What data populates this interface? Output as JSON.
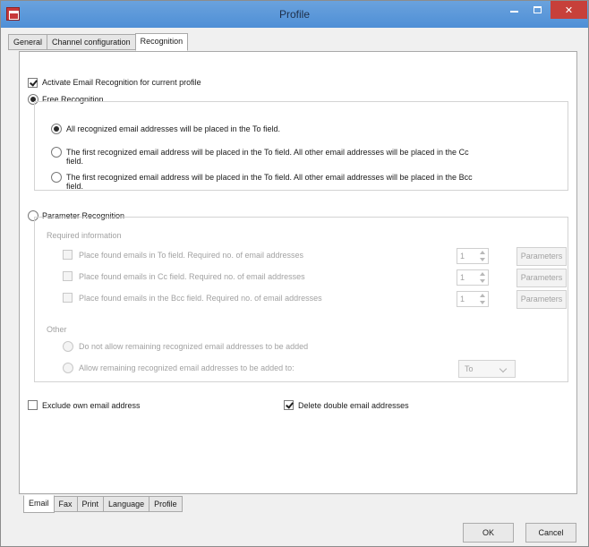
{
  "window": {
    "title": "Profile"
  },
  "top_tabs": [
    "General",
    "Channel configuration",
    "Recognition"
  ],
  "recognition": {
    "activate_label": "Activate Email Recognition for current profile",
    "activate_checked": true,
    "free_recognition": {
      "label": "Free Recognition",
      "selected": true,
      "options": [
        {
          "line1": "All recognized email addresses will be placed in the To field.",
          "line2": "",
          "selected": true
        },
        {
          "line1": "The first recognized email address will be placed in the To field. All other email addresses will be placed in the Cc",
          "line2": "field.",
          "selected": false
        },
        {
          "line1": "The first recognized email address will be placed in the To field. All other email addresses will be placed in the Bcc",
          "line2": "field.",
          "selected": false
        }
      ]
    },
    "parameter_recognition": {
      "label": "Parameter Recognition",
      "selected": false,
      "required_heading": "Required information",
      "rows": [
        {
          "label": "Place found emails in To field. Required no. of email addresses",
          "value": "1",
          "button": "Parameters"
        },
        {
          "label": "Place found emails in Cc field. Required no. of email addresses",
          "value": "1",
          "button": "Parameters"
        },
        {
          "label": "Place found emails in the Bcc field. Required no. of email addresses",
          "value": "1",
          "button": "Parameters"
        }
      ],
      "other_heading": "Other",
      "other_options": [
        {
          "label": "Do not allow remaining recognized email addresses to be added"
        },
        {
          "label": "Allow remaining recognized email addresses to be added to:"
        }
      ],
      "target_field": "To"
    },
    "exclude_own": {
      "label": "Exclude own email address",
      "checked": false
    },
    "delete_double": {
      "label": "Delete double email addresses",
      "checked": true
    }
  },
  "bottom_tabs": [
    "Email",
    "Fax",
    "Print",
    "Language",
    "Profile"
  ],
  "buttons": {
    "ok": "OK",
    "cancel": "Cancel"
  }
}
